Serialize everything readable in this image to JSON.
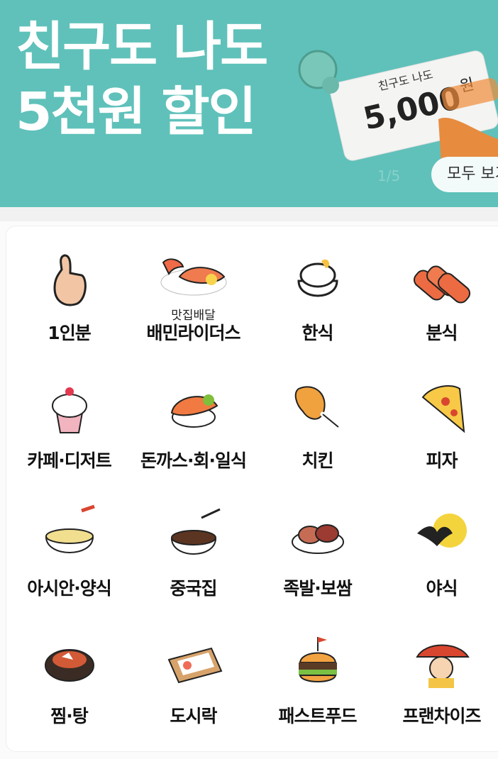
{
  "banner": {
    "title_line1": "친구도 나도",
    "title_line2": "5천원 할인",
    "coupon_top": "친구도 나도",
    "coupon_amount": "5,000",
    "coupon_unit": "원",
    "pager": "1/5",
    "all_button": "모두 보기"
  },
  "categories": [
    {
      "label": "1인분",
      "sub": "",
      "icon": "one-person-hand-icon"
    },
    {
      "label": "배민라이더스",
      "sub": "맛집배달",
      "icon": "lobster-icon"
    },
    {
      "label": "한식",
      "sub": "",
      "icon": "rice-bowl-icon"
    },
    {
      "label": "분식",
      "sub": "",
      "icon": "tteokbokki-icon"
    },
    {
      "label": "카페·디저트",
      "sub": "",
      "icon": "cupcake-icon"
    },
    {
      "label": "돈까스·회·일식",
      "sub": "",
      "icon": "sushi-icon"
    },
    {
      "label": "치킨",
      "sub": "",
      "icon": "chicken-leg-icon"
    },
    {
      "label": "피자",
      "sub": "",
      "icon": "pizza-slice-icon"
    },
    {
      "label": "아시안·양식",
      "sub": "",
      "icon": "noodle-bowl-icon"
    },
    {
      "label": "중국집",
      "sub": "",
      "icon": "jajangmyeon-icon"
    },
    {
      "label": "족발·보쌈",
      "sub": "",
      "icon": "jokbal-icon"
    },
    {
      "label": "야식",
      "sub": "",
      "icon": "bat-moon-icon"
    },
    {
      "label": "찜·탕",
      "sub": "",
      "icon": "stew-pot-icon"
    },
    {
      "label": "도시락",
      "sub": "",
      "icon": "lunchbox-icon"
    },
    {
      "label": "패스트푸드",
      "sub": "",
      "icon": "burger-icon"
    },
    {
      "label": "프랜차이즈",
      "sub": "",
      "icon": "franchise-chef-icon"
    }
  ]
}
